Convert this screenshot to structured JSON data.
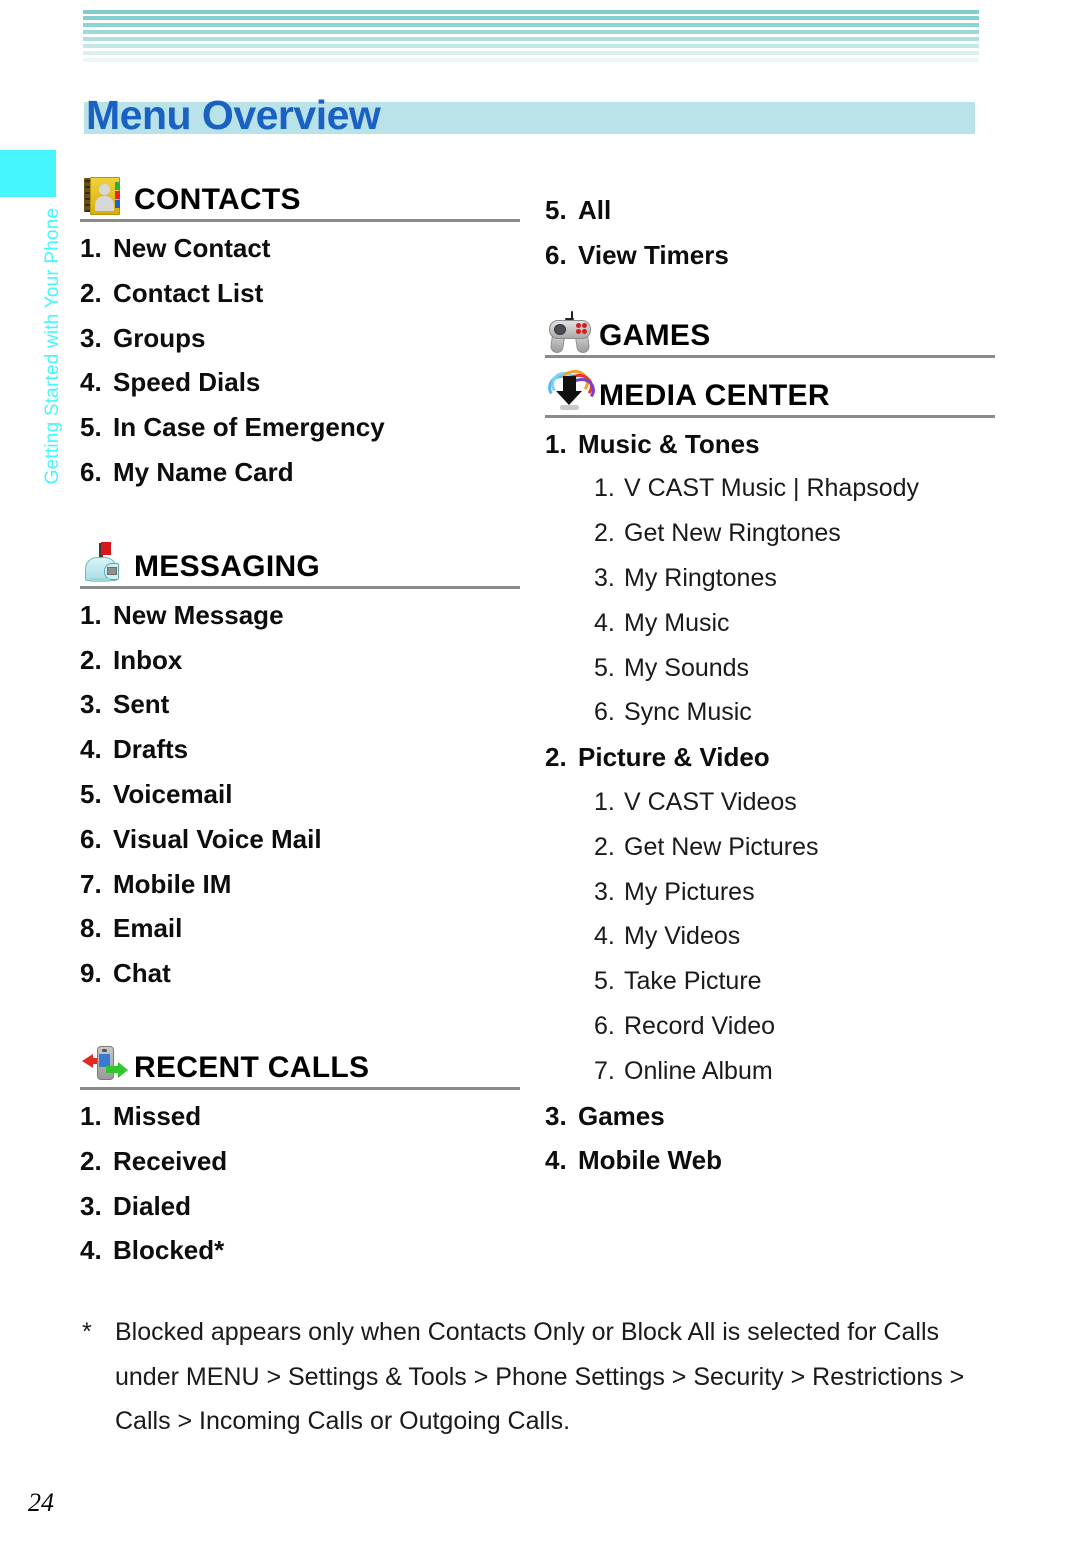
{
  "page": {
    "title": "Menu Overview",
    "number": "24",
    "side_tab_label": "Getting Started with Your Phone"
  },
  "colors": {
    "title_text": "#1a61c4",
    "title_band": "#b9e3e9",
    "side_tab": "#45f6ff",
    "stripe_top": "#7acfcf",
    "rule": "#8a8a8a"
  },
  "left_column": [
    {
      "icon": "address-book-icon",
      "title": "CONTACTS",
      "items": [
        {
          "num": "1.",
          "label": "New Contact"
        },
        {
          "num": "2.",
          "label": "Contact List"
        },
        {
          "num": "3.",
          "label": "Groups"
        },
        {
          "num": "4.",
          "label": "Speed Dials"
        },
        {
          "num": "5.",
          "label": "In Case of Emergency"
        },
        {
          "num": "6.",
          "label": "My Name Card"
        }
      ]
    },
    {
      "icon": "mailbox-icon",
      "title": "MESSAGING",
      "items": [
        {
          "num": "1.",
          "label": "New Message"
        },
        {
          "num": "2.",
          "label": "Inbox"
        },
        {
          "num": "3.",
          "label": "Sent"
        },
        {
          "num": "4.",
          "label": "Drafts"
        },
        {
          "num": "5.",
          "label": "Voicemail"
        },
        {
          "num": "6.",
          "label": "Visual Voice Mail"
        },
        {
          "num": "7.",
          "label": "Mobile IM"
        },
        {
          "num": "8.",
          "label": "Email"
        },
        {
          "num": "9.",
          "label": "Chat"
        }
      ]
    },
    {
      "icon": "phone-arrows-icon",
      "title": "RECENT CALLS",
      "items": [
        {
          "num": "1.",
          "label": "Missed"
        },
        {
          "num": "2.",
          "label": "Received"
        },
        {
          "num": "3.",
          "label": "Dialed"
        },
        {
          "num": "4.",
          "label": "Blocked*"
        }
      ]
    }
  ],
  "right_column": {
    "continued_items": [
      {
        "num": "5.",
        "label": "All"
      },
      {
        "num": "6.",
        "label": "View Timers"
      }
    ],
    "games_section": {
      "icon": "gamepad-icon",
      "title": "GAMES"
    },
    "media_section": {
      "icon": "download-arrow-icon",
      "title": "MEDIA CENTER",
      "items": [
        {
          "num": "1.",
          "label": "Music & Tones",
          "subs": [
            {
              "num": "1.",
              "label": "V CAST Music | Rhapsody"
            },
            {
              "num": "2.",
              "label": "Get New Ringtones"
            },
            {
              "num": "3.",
              "label": "My Ringtones"
            },
            {
              "num": "4.",
              "label": "My Music"
            },
            {
              "num": "5.",
              "label": "My Sounds"
            },
            {
              "num": "6.",
              "label": "Sync Music"
            }
          ]
        },
        {
          "num": "2.",
          "label": "Picture & Video",
          "subs": [
            {
              "num": "1.",
              "label": "V CAST Videos"
            },
            {
              "num": "2.",
              "label": "Get New Pictures"
            },
            {
              "num": "3.",
              "label": "My Pictures"
            },
            {
              "num": "4.",
              "label": "My Videos"
            },
            {
              "num": "5.",
              "label": "Take Picture"
            },
            {
              "num": "6.",
              "label": "Record Video"
            },
            {
              "num": "7.",
              "label": "Online Album"
            }
          ]
        },
        {
          "num": "3.",
          "label": "Games",
          "subs": []
        },
        {
          "num": "4.",
          "label": "Mobile Web",
          "subs": []
        }
      ]
    }
  },
  "footnote": {
    "marker": "*",
    "text": "Blocked appears only when Contacts Only or Block All is selected for Calls under MENU > Settings & Tools > Phone Settings > Security > Restrictions > Calls > Incoming Calls or Outgoing Calls."
  }
}
